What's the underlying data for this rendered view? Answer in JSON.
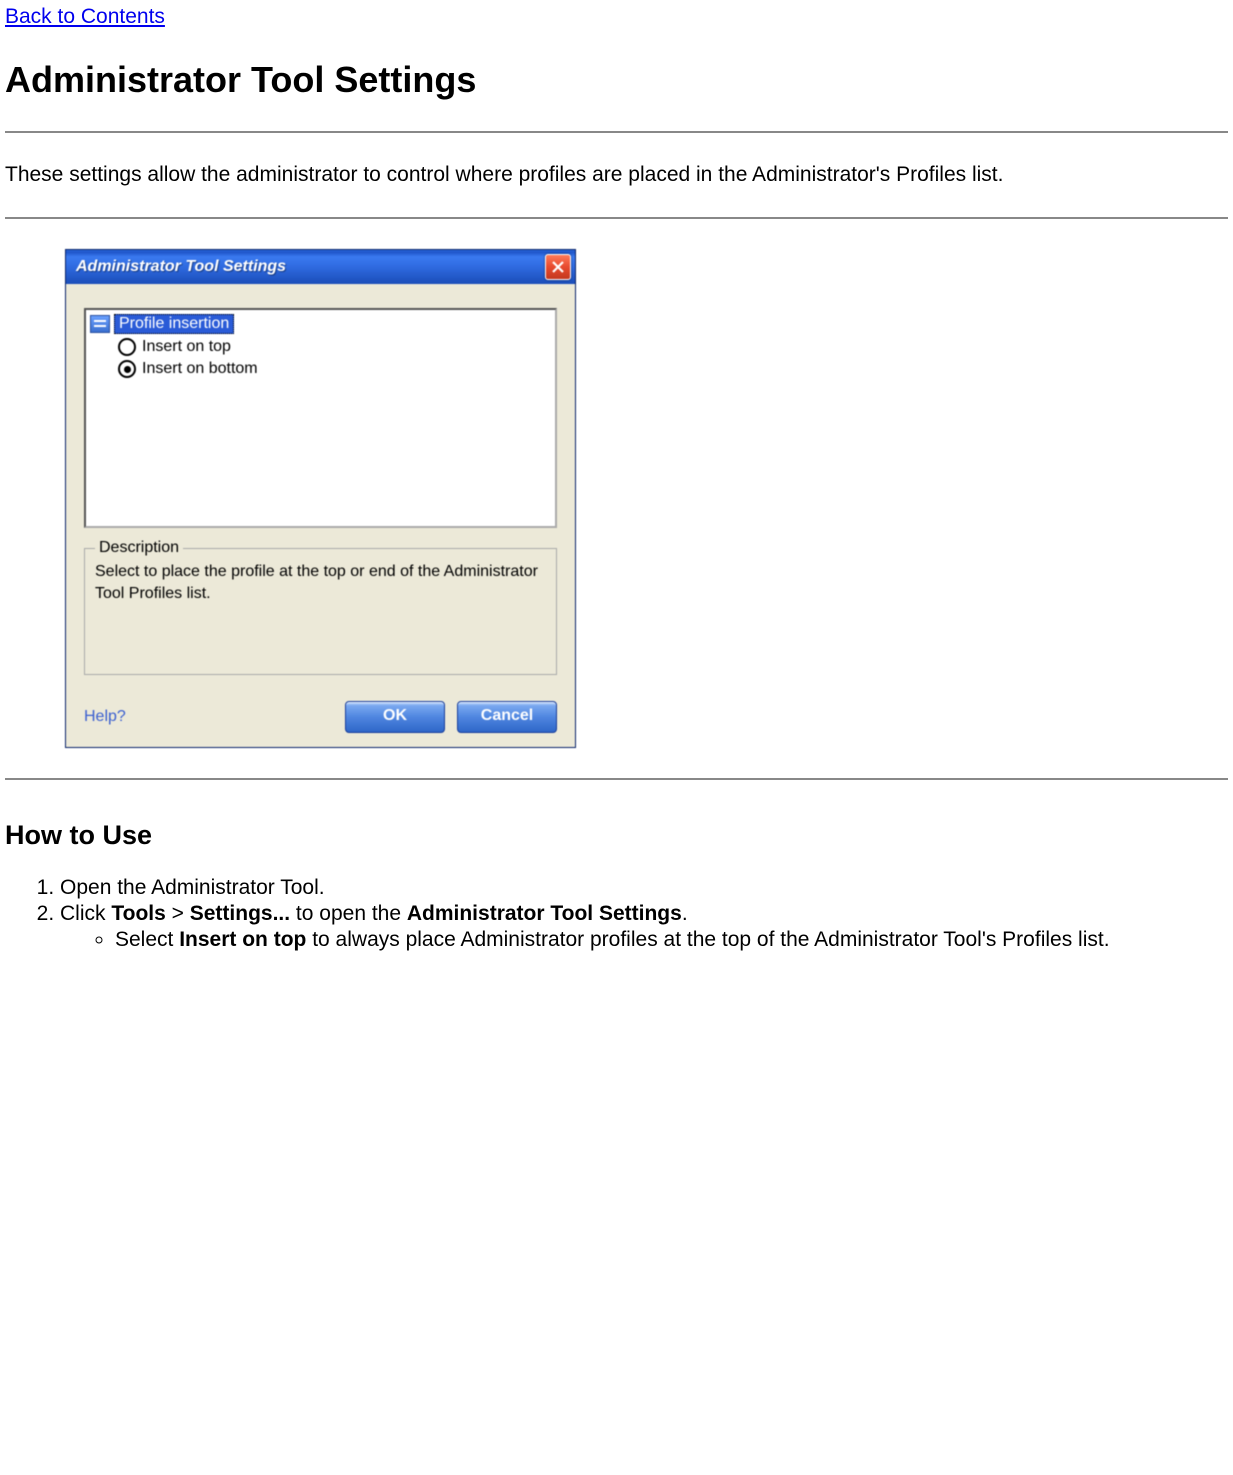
{
  "nav": {
    "back_link": "Back to Contents"
  },
  "page": {
    "title": "Administrator Tool Settings",
    "intro": "These settings allow the administrator to control where profiles are placed in the Administrator's Profiles list."
  },
  "dialog": {
    "title": "Administrator Tool Settings",
    "tree_header": "Profile insertion",
    "radio_top": "Insert on top",
    "radio_bottom": "Insert on bottom",
    "group_legend": "Description",
    "group_text": "Select to place the profile at the top or end of the Administrator Tool Profiles list.",
    "help": "Help?",
    "ok": "OK",
    "cancel": "Cancel"
  },
  "howto": {
    "heading": "How to Use",
    "step1": "Open the Administrator Tool.",
    "step2_pre": "Click ",
    "step2_b1": "Tools",
    "step2_gt": " > ",
    "step2_b2": "Settings...",
    "step2_mid": " to open the ",
    "step2_b3": "Administrator Tool Settings",
    "step2_post": ".",
    "sub_pre": "Select ",
    "sub_b": "Insert on top",
    "sub_post": " to always place Administrator profiles at the top of the Administrator Tool's Profiles list."
  }
}
